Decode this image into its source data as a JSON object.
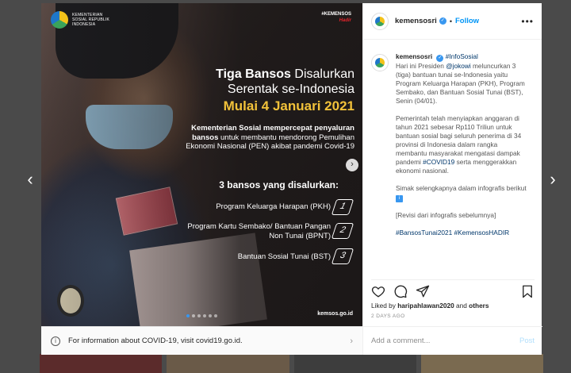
{
  "nav": {
    "prev_glyph": "‹",
    "next_glyph": "›"
  },
  "media": {
    "org_name": "KEMENTERIAN SOSIAL REPUBLIK INDONESIA",
    "hashtag": "#KEMENSOS",
    "hashtag_sub": "Hadir",
    "headline_bold": "Tiga Bansos",
    "headline_rest": "Disalurkan",
    "headline_line2": "Serentak se-Indonesia",
    "headline_date": "Mulai 4 Januari 2021",
    "desc_bold": "Kementerian Sosial mempercepat penyaluran bansos",
    "desc_rest": "untuk membantu mendorong Pemulihan Ekonomi Nasional (PEN) akibat pandemi Covid-19",
    "list_title": "3 bansos yang disalurkan:",
    "items": [
      {
        "label": "Program Keluarga Harapan (PKH)",
        "num": "1"
      },
      {
        "label": "Program Kartu Sembako/ Bantuan Pangan Non Tunai (BPNT)",
        "num": "2"
      },
      {
        "label": "Bantuan Sosial Tunai (BST)",
        "num": "3"
      }
    ],
    "website": "kemsos.go.id",
    "next_glyph": "›",
    "slide_count": 6,
    "active_slide": 0
  },
  "covid_bar": {
    "text": "For information about COVID-19, visit covid19.go.id.",
    "chevron": "›"
  },
  "header": {
    "username": "kemensosri",
    "separator": "•",
    "follow_label": "Follow",
    "more_label": "•••"
  },
  "caption": {
    "username": "kemensosri",
    "hashtag_title": "#InfoSosial",
    "p1_a": "Hari ini Presiden",
    "p1_mention": "@jokowi",
    "p1_b": "meluncurkan 3 (tiga) bantuan tunai se-Indonesia yaitu Program Keluarga Harapan (PKH), Program Sembako, dan Bantuan Sosial Tunai (BST), Senin (04/01).",
    "p2_a": "Pemerintah telah menyiapkan anggaran di tahun 2021 sebesar Rp110 Triliun untuk bantuan sosial bagi seluruh penerima di 34 provinsi di Indonesia dalam rangka membantu masyarakat mengatasi dampak pandemi",
    "p2_tag": "#COVID19",
    "p2_b": "serta menggerakkan ekonomi nasional.",
    "p3": "Simak selengkapnya dalam infografis berikut",
    "p3_emoji": "i",
    "p4": "[Revisi dari infografis sebelumnya]",
    "tags": "#BansosTunai2021 #KemensosHADIR"
  },
  "engagement": {
    "liked_prefix": "Liked by",
    "liked_user": "haripahlawan2020",
    "liked_suffix": "and",
    "liked_others": "others",
    "date": "2 DAYS AGO"
  },
  "comment": {
    "placeholder": "Add a comment...",
    "post_label": "Post"
  },
  "colors": {
    "accent": "#0095f6",
    "headline_gold": "#f2c23a",
    "verified": "#3897f0"
  }
}
